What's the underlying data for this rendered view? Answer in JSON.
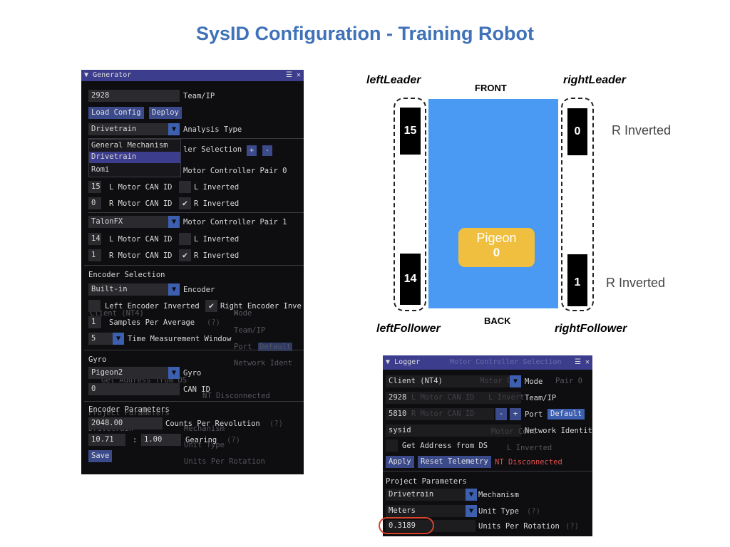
{
  "slide": {
    "title": "SysID Configuration - Training Robot"
  },
  "generator": {
    "title": "Generator",
    "team_value": "2928",
    "team_label": "Team/IP",
    "load_config": "Load Config",
    "deploy": "Deploy",
    "analysis_value": "Drivetrain",
    "analysis_label": "Analysis Type",
    "dropdown_options": [
      "General Mechanism",
      "Drivetrain",
      "Romi"
    ],
    "controller_selection_label": "ler Selection",
    "plus": "+",
    "minus": "-",
    "pair0_label": "Motor Controller Pair 0",
    "pair0_l_id": "15",
    "l_can_label": "L Motor CAN ID",
    "l_inverted_label": "L Inverted",
    "pair0_r_id": "0",
    "r_can_label": "R Motor CAN ID",
    "r_inverted_label": "R Inverted",
    "pair1_type": "TalonFX",
    "pair1_label": "Motor Controller Pair 1",
    "pair1_l_id": "14",
    "pair1_r_id": "1",
    "encoder_selection": "Encoder Selection",
    "encoder_value": "Built-in",
    "encoder_label": "Encoder",
    "left_enc_inv": "Left Encoder Inverted",
    "right_enc_inv": "Right Encoder Inve",
    "samples_value": "1",
    "samples_label": "Samples Per Average",
    "help": "(?)",
    "time_window_value": "5",
    "time_window_label": "Time Measurement Window",
    "gyro_header": "Gyro",
    "gyro_value": "Pigeon2",
    "gyro_label": "Gyro",
    "can_id_value": "0",
    "can_id_label": "CAN ID",
    "enc_params": "Encoder Parameters",
    "cpr_value": "2048.00",
    "cpr_label": "Counts Per Revolution",
    "gear_a": "10.71",
    "gear_colon": ":",
    "gear_b": "1.00",
    "gearing_label": "Gearing",
    "save": "Save",
    "ghost_client": "Client (NT4)",
    "ghost_mode": "Mode",
    "ghost_team": "Team/IP",
    "ghost_port": "Port",
    "ghost_default": "Default",
    "ghost_network": "Network Ident",
    "ghost_get_addr": "Get Address from DS",
    "ghost_disconnected": "NT Disconnected",
    "ghost_project": "Project Parameters",
    "ghost_drivetrain": "Drivetrain",
    "ghost_mechanism": "Mechanism",
    "ghost_unit_type": "Unit Type",
    "ghost_upr": "Units Per Rotation"
  },
  "diagram": {
    "left_leader": "leftLeader",
    "right_leader": "rightLeader",
    "left_follower": "leftFollower",
    "right_follower": "rightFollower",
    "front": "FRONT",
    "back": "BACK",
    "m_left_leader": "15",
    "m_left_follower": "14",
    "m_right_leader": "0",
    "m_right_follower": "1",
    "r_inverted_top": "R Inverted",
    "r_inverted_bottom": "R Inverted",
    "pigeon_label": "Pigeon",
    "pigeon_id": "0"
  },
  "logger": {
    "title": "Logger",
    "ghost_title": "Motor Controller Selection",
    "mode_value": "Client (NT4)",
    "mode_label": "Mode",
    "team_value": "2928",
    "team_label": "Team/IP",
    "port_value": "5810",
    "port_minus": "-",
    "port_plus": "+",
    "port_label": "Port",
    "default": "Default",
    "network_value": "sysid",
    "network_label": "Network Identit",
    "get_address": "Get Address from DS",
    "apply": "Apply",
    "reset_telemetry": "Reset Telemetry",
    "nt_status": "NT Disconnected",
    "project_params": "Project Parameters",
    "mechanism_value": "Drivetrain",
    "mechanism_label": "Mechanism",
    "unit_type_value": "Meters",
    "unit_type_label": "Unit Type",
    "help": "(?)",
    "upr_value": "0.3189",
    "upr_label": "Units Per Rotation",
    "ghost_pair0": "Pair 0",
    "ghost_lcan": "L Motor CAN ID",
    "ghost_linv": "L Invert",
    "ghost_rcan": "R Motor CAN ID",
    "ghost_motor_con": "Motor Con",
    "ghost_motor_cont": "Motor Cont",
    "ghost_l_inverted": "L Inverted"
  },
  "colors": {
    "title_blue": "#3f72b8",
    "robot_blue": "#4a9af3",
    "pigeon_yellow": "#f0bf3f",
    "highlight_red": "#d9442a",
    "nt_red": "#e05050"
  }
}
